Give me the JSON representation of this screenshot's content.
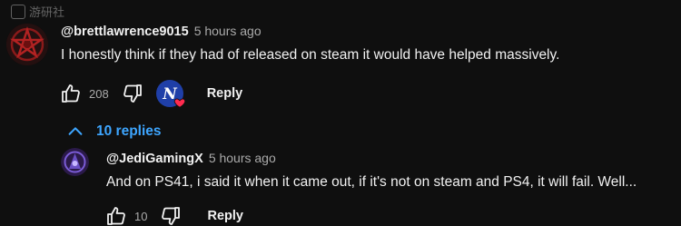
{
  "watermark": {
    "text": "游研社"
  },
  "colors": {
    "background": "#0f0f0f",
    "text_primary": "#f1f1f1",
    "text_secondary": "#aaaaaa",
    "link_blue": "#3ea6ff",
    "heart_red": "#ff2b4f"
  },
  "comment": {
    "author": "@brettlawrence9015",
    "time": "5 hours ago",
    "text": "I honestly think if they had of released on steam it would have helped massively.",
    "like_count": "208",
    "reply_label": "Reply",
    "creator_heart": true,
    "avatar_icon": "pentagram-icon"
  },
  "replies_toggle": {
    "label": "10 replies",
    "icon": "chevron-up-icon"
  },
  "reply": {
    "author": "@JediGamingX",
    "time": "5 hours ago",
    "text": "And on PS41, i said it when it came out, if it's not on steam and PS4, it will fail. Well...",
    "like_count": "10",
    "reply_label": "Reply",
    "avatar_icon": "gaming-logo-icon"
  }
}
